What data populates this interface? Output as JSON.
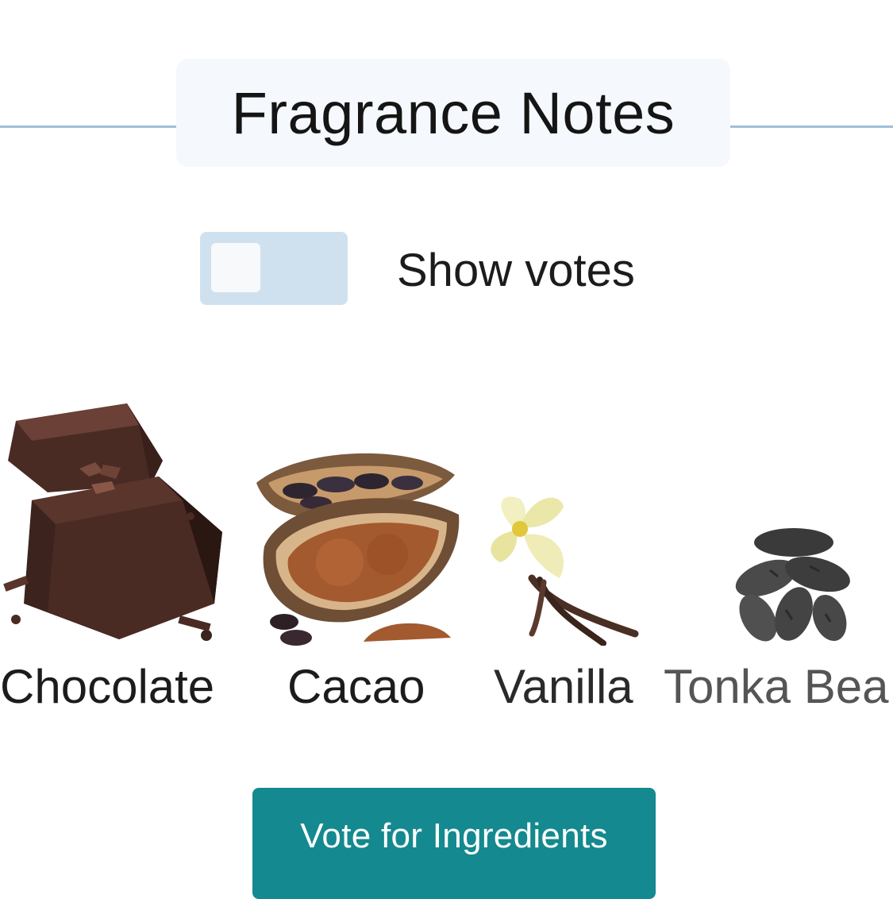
{
  "section": {
    "title": "Fragrance Notes"
  },
  "toggle": {
    "label": "Show votes",
    "checked": false
  },
  "notes": [
    {
      "name": "Chocolate",
      "image_icon": "chocolate-image"
    },
    {
      "name": "Cacao",
      "image_icon": "cacao-image"
    },
    {
      "name": "Vanilla",
      "image_icon": "vanilla-image"
    },
    {
      "name": "Tonka Bea",
      "image_icon": "tonka-bean-image"
    }
  ],
  "actions": {
    "vote_label": "Vote for Ingredients"
  },
  "colors": {
    "accent": "#14898f",
    "header_line": "#9fbfd8",
    "toggle_track": "#cfe1ef"
  }
}
